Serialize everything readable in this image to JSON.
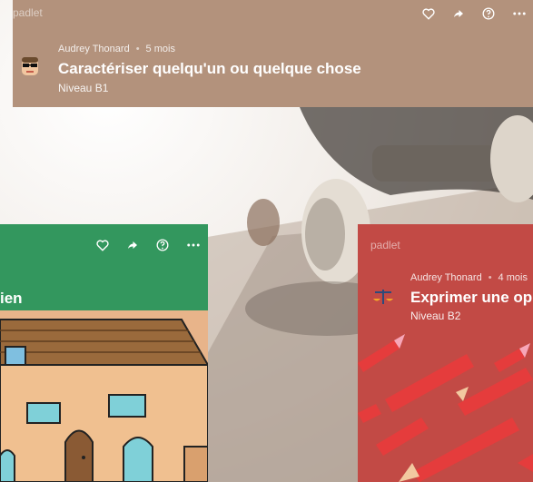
{
  "top_card": {
    "brand": "padlet",
    "author": "Audrey Thonard",
    "time": "5 mois",
    "title": "Caractériser quelqu'un ou quelque chose",
    "level": "Niveau B1"
  },
  "left_card": {
    "title_fragment": "ien"
  },
  "right_card": {
    "brand": "padlet",
    "author": "Audrey Thonard",
    "time": "4 mois",
    "title": "Exprimer une op",
    "level": "Niveau B2"
  },
  "colors": {
    "top": "#b3927c",
    "left": "#33975e",
    "right": "#c24a45"
  }
}
